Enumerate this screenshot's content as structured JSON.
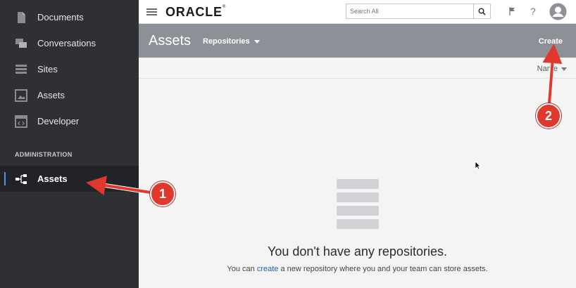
{
  "sidebar": {
    "items": [
      {
        "label": "Documents",
        "icon": "document-icon"
      },
      {
        "label": "Conversations",
        "icon": "conversations-icon"
      },
      {
        "label": "Sites",
        "icon": "sites-icon"
      },
      {
        "label": "Assets",
        "icon": "assets-image-icon"
      },
      {
        "label": "Developer",
        "icon": "developer-icon"
      }
    ],
    "section_heading": "ADMINISTRATION",
    "admin_items": [
      {
        "label": "Assets",
        "icon": "repository-tree-icon",
        "active": true
      }
    ]
  },
  "topbar": {
    "logo": "ORACLE",
    "search_placeholder": "Search All",
    "icons": [
      "menu-icon",
      "search-icon",
      "flag-icon",
      "help-icon",
      "user-avatar-icon"
    ]
  },
  "header": {
    "title": "Assets",
    "repositories_dropdown": "Repositories",
    "create_label": "Create"
  },
  "sort": {
    "label": "Name"
  },
  "empty_state": {
    "title": "You don't have any repositories.",
    "subtitle_before": "You can ",
    "subtitle_link": "create",
    "subtitle_after": " a new repository where you and your team can store assets."
  },
  "annotations": {
    "badge_1": "1",
    "badge_2": "2"
  },
  "colors": {
    "sidebar_bg": "#2f3033",
    "header_bg": "#8e9097",
    "accent": "#5b8fd8",
    "annotation_red": "#e0382d",
    "link": "#1f5fb4"
  }
}
